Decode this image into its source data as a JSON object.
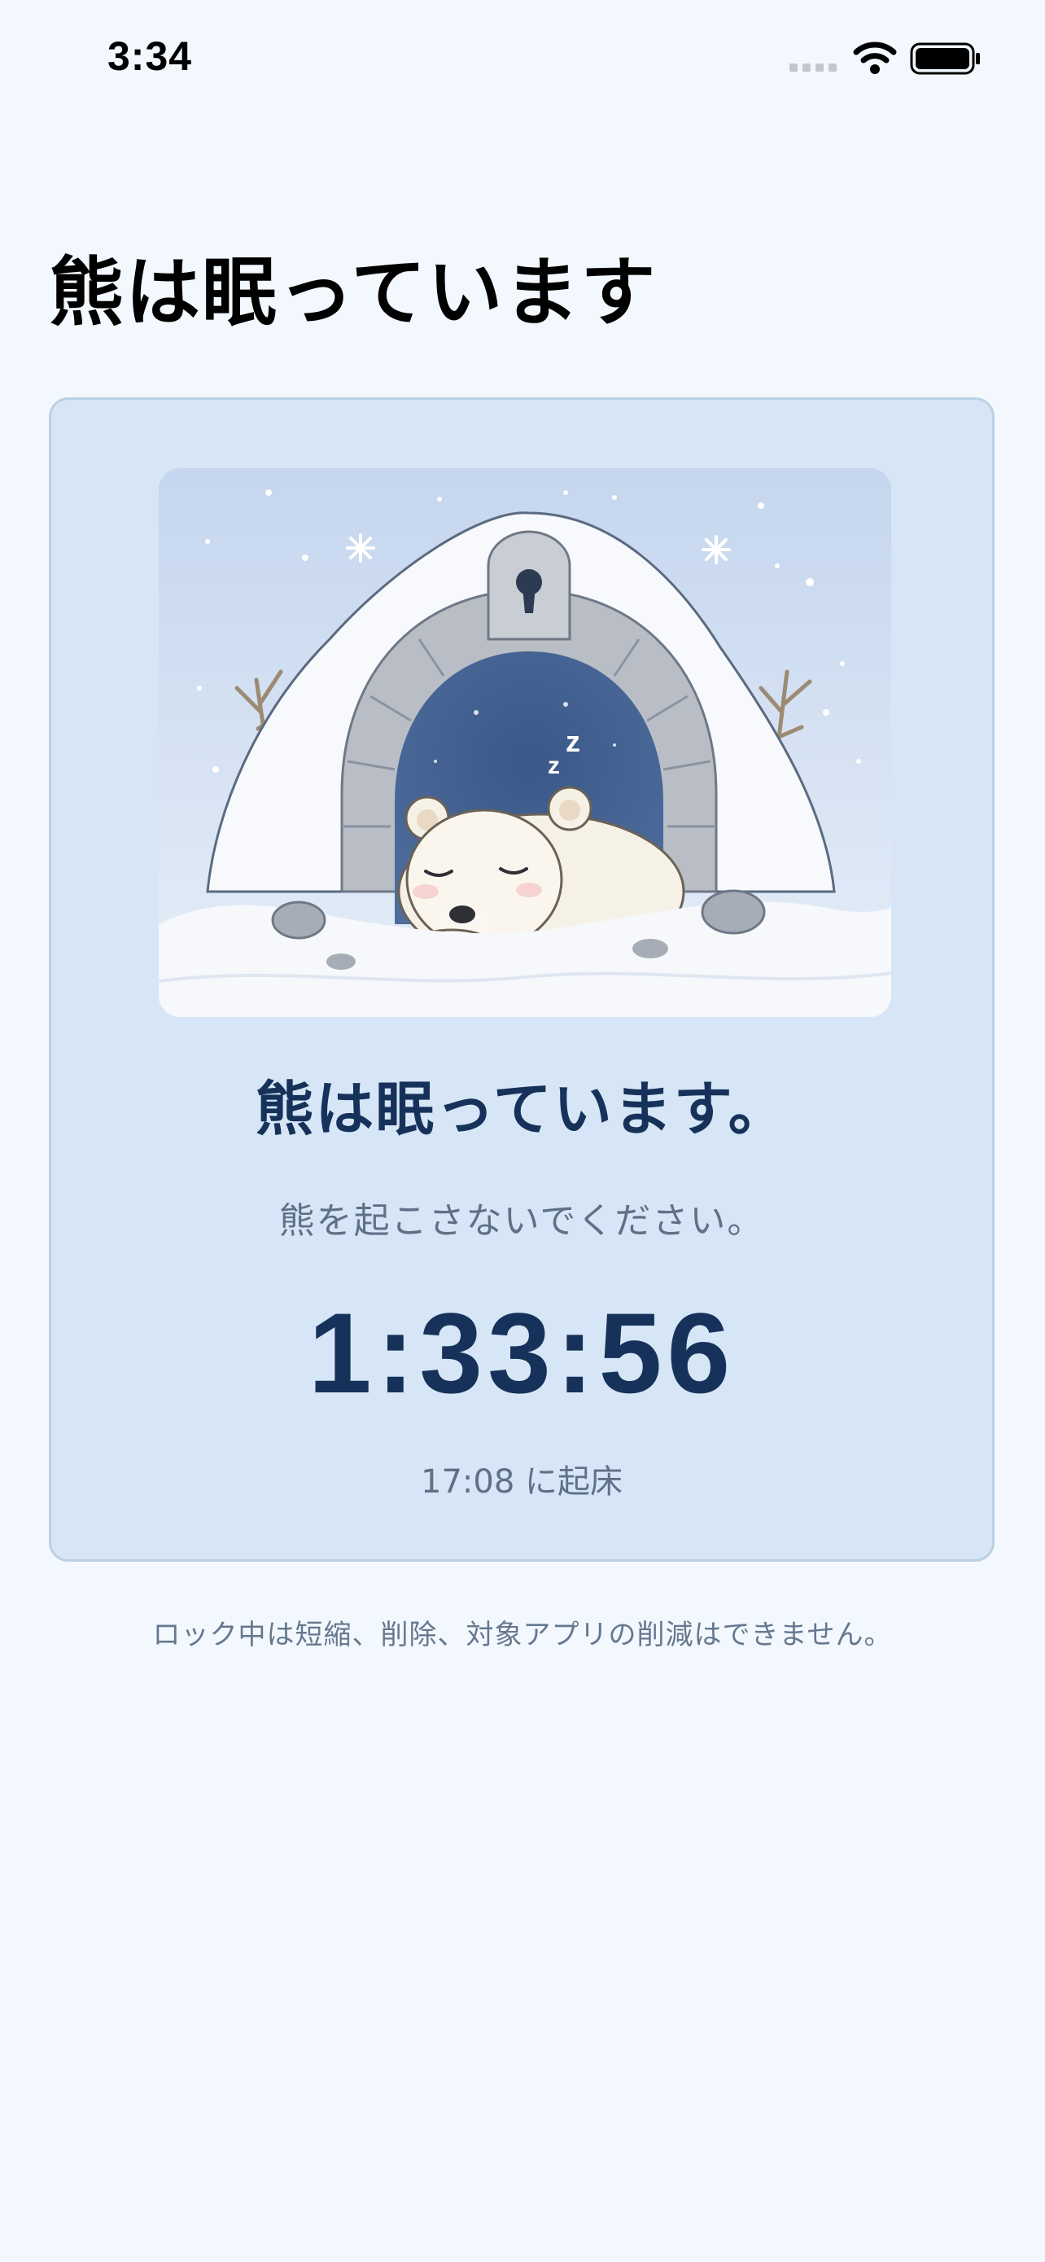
{
  "status_bar": {
    "time": "3:34",
    "icons": [
      "cellular-signal-icon",
      "wifi-icon",
      "battery-icon"
    ]
  },
  "page": {
    "title": "熊は眠っています"
  },
  "card": {
    "illustration": "sleeping-polar-bear-igloo-illustration",
    "headline": "熊は眠っています。",
    "subtitle": "熊を起こさないでください。",
    "timer": "1:33:56",
    "wake_time": "17:08 に起床"
  },
  "footer": {
    "note": "ロック中は短縮、削除、対象アプリの削減はできません。"
  },
  "colors": {
    "background": "#f2f8fe",
    "card": "#d6e6f6",
    "card_border": "#bcd0e3",
    "primary_text": "#17325a",
    "secondary_text": "#5f7088"
  }
}
